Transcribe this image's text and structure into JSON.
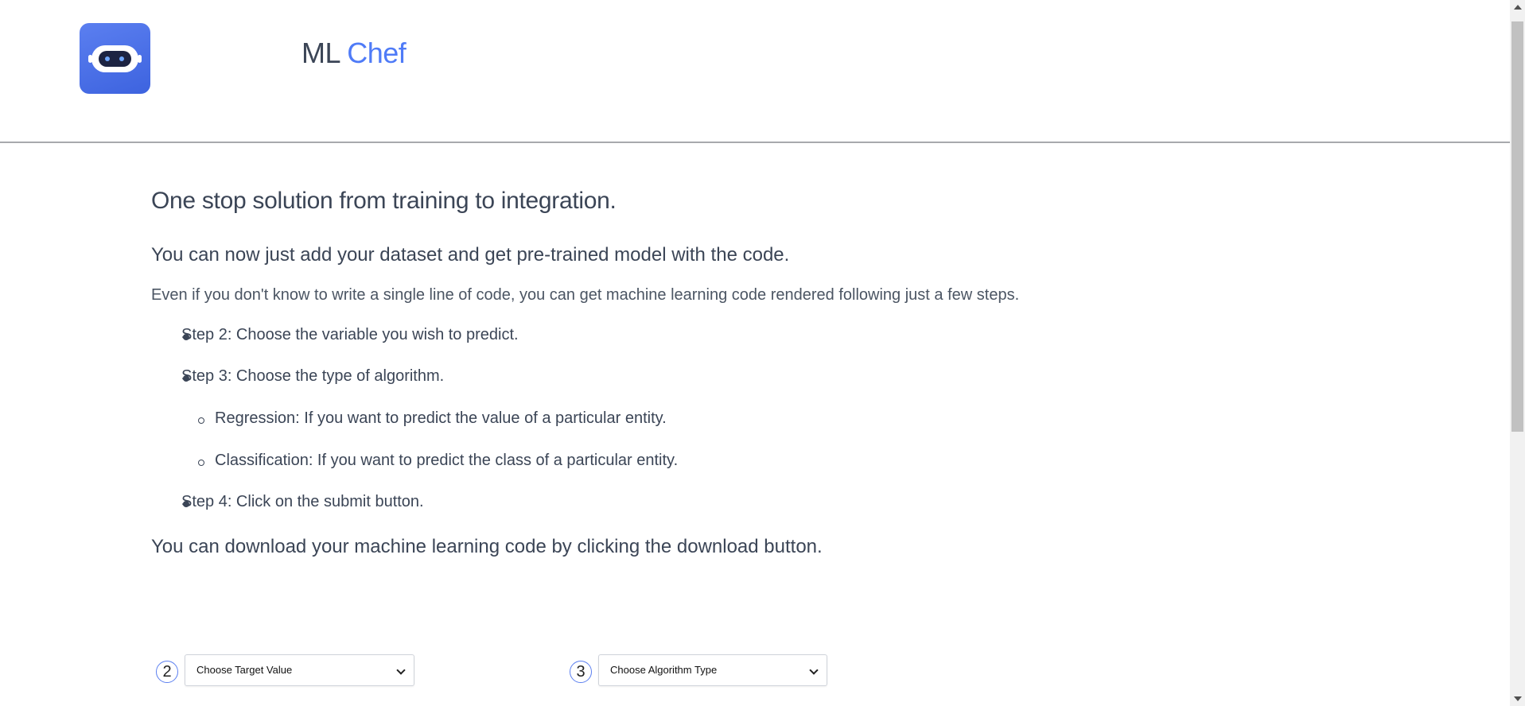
{
  "header": {
    "brand_primary": "ML",
    "brand_accent": "Chef",
    "logo_icon": "robot-icon"
  },
  "main": {
    "headline": "One stop solution from training to integration.",
    "subhead": "You can now just add your dataset and get pre-trained model with the code.",
    "lead": "Even if you don't know to write a single line of code, you can get machine learning code rendered following just a few steps.",
    "steps": [
      "Step 2: Choose the variable you wish to predict.",
      "Step 3: Choose the type of algorithm.",
      "Step 4: Click on the submit button."
    ],
    "algorithm_types": [
      "Regression: If you want to predict the value of a particular entity.",
      "Classification: If you want to predict the class of a particular entity."
    ],
    "download_note": "You can download your machine learning code by clicking the download button."
  },
  "form": {
    "target": {
      "step_number": "2",
      "selected": "Choose Target Value"
    },
    "algorithm": {
      "step_number": "3",
      "selected": "Choose Algorithm Type"
    }
  },
  "colors": {
    "accent": "#4f7bf7",
    "text": "#3b4556",
    "logo_bg": "#4a6fe8"
  }
}
